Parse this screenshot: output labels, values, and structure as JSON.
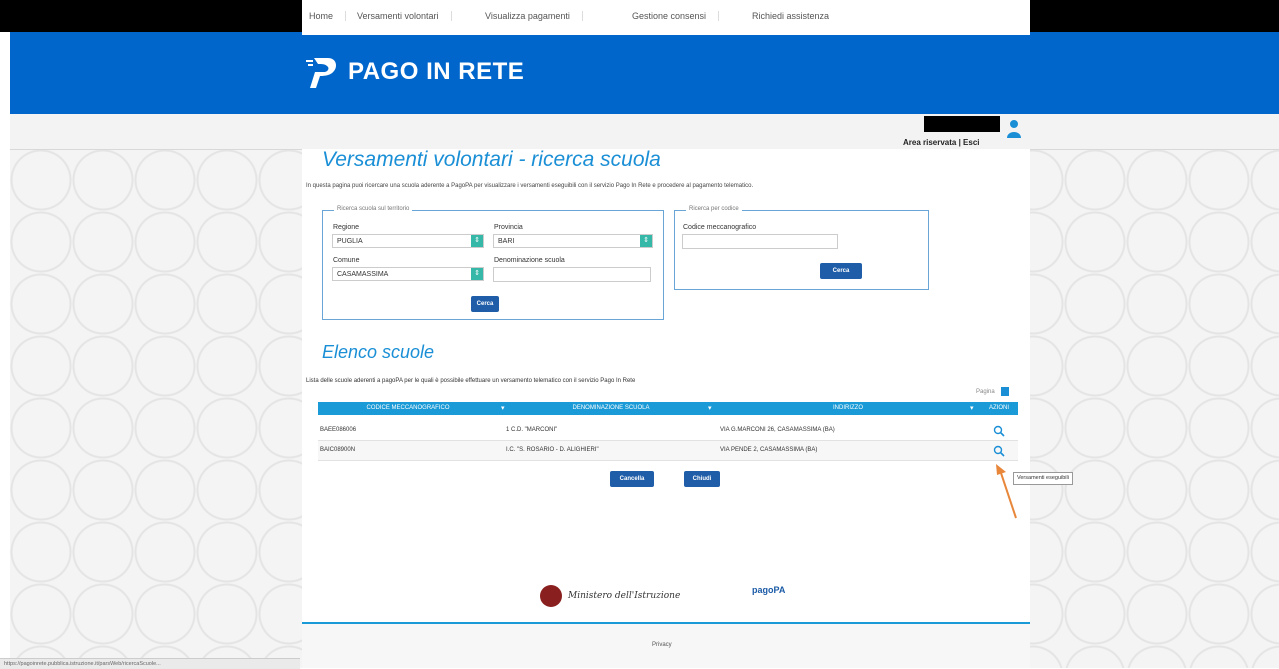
{
  "app": {
    "title": "PAGO IN RETE"
  },
  "nav": {
    "items": [
      "Home",
      "Versamenti volontari",
      "Visualizza pagamenti",
      "Gestione consensi",
      "Richiedi assistenza"
    ],
    "area_riservata": "Area riservata | Esci"
  },
  "search": {
    "title": "Versamenti volontari - ricerca scuola",
    "description": "In questa pagina puoi ricercare una scuola aderente a PagoPA per visualizzare i versamenti eseguibili con il servizio Pago In Rete e procedere al pagamento telematico.",
    "territory": {
      "legend": "Ricerca scuola sul territorio",
      "regione_label": "Regione",
      "regione_value": "PUGLIA",
      "provincia_label": "Provincia",
      "provincia_value": "BARI",
      "comune_label": "Comune",
      "comune_value": "CASAMASSIMA",
      "denominazione_label": "Denominazione scuola",
      "denominazione_value": "",
      "button": "Cerca"
    },
    "code": {
      "legend": "Ricerca per codice",
      "codice_label": "Codice meccanografico",
      "codice_value": "",
      "button": "Cerca"
    }
  },
  "list": {
    "title": "Elenco scuole",
    "description": "Lista delle scuole aderenti a pagoPA per le quali è possibile effettuare un versamento telematico con il servizio Pago In Rete",
    "pagina": "Pagina",
    "columns": [
      "CODICE MECCANOGRAFICO",
      "DENOMINAZIONE SCUOLA",
      "INDIRIZZO",
      "AZIONI"
    ],
    "rows": [
      {
        "codice": "BAEE086006",
        "denominazione": "1 C.D. \"MARCONI\"",
        "indirizzo": "VIA G.MARCONI 26, CASAMASSIMA (BA)"
      },
      {
        "codice": "BAIC08900N",
        "denominazione": "I.C. \"S. ROSARIO - D. ALIGHIERI\"",
        "indirizzo": "VIA PENDE 2, CASAMASSIMA (BA)"
      }
    ],
    "tooltip": "Versamenti eseguibili",
    "buttons": {
      "cancel": "Cancella",
      "close": "Chiudi"
    }
  },
  "footer": {
    "ministero": "Ministero dell'Istruzione",
    "pagopa": "pagoPA",
    "link": "Privacy"
  },
  "status_url": "https://pagoinrete.pubblica.istruzione.it/parsWeb/ricercaScuole..."
}
